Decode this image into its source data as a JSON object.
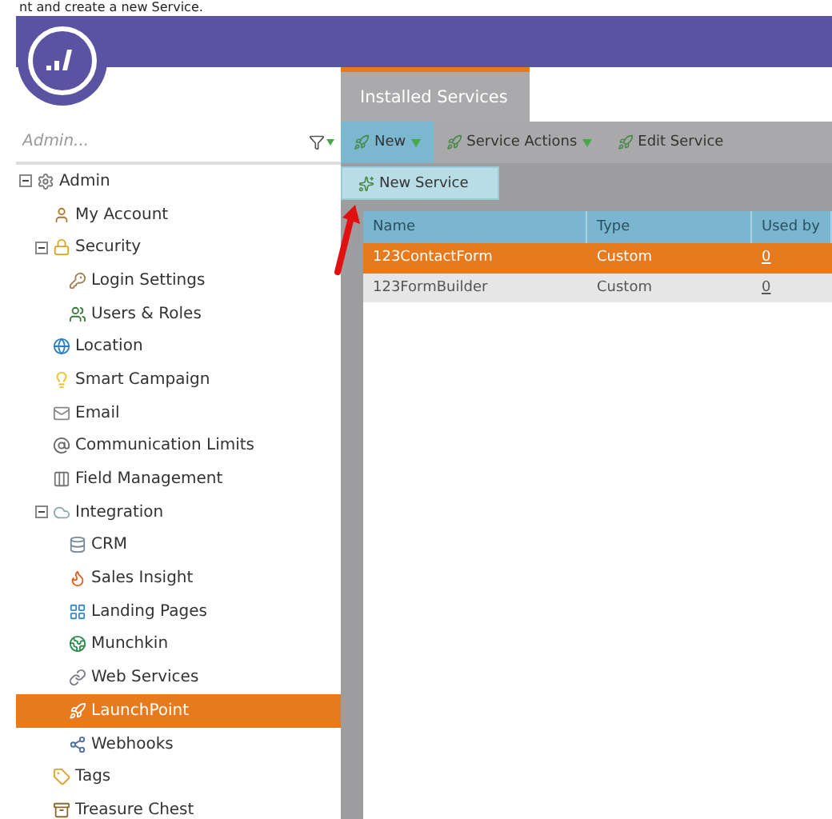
{
  "caption": "nt and create a new Service.",
  "search": {
    "placeholder": "Admin..."
  },
  "tree": [
    {
      "label": "Admin",
      "expanded": true,
      "selected": false,
      "children": [
        {
          "label": "My Account",
          "selected": false
        },
        {
          "label": "Security",
          "expanded": true,
          "selected": false,
          "children": [
            {
              "label": "Login Settings",
              "selected": false
            },
            {
              "label": "Users & Roles",
              "selected": false
            }
          ]
        },
        {
          "label": "Location",
          "selected": false
        },
        {
          "label": "Smart Campaign",
          "selected": false
        },
        {
          "label": "Email",
          "selected": false
        },
        {
          "label": "Communication Limits",
          "selected": false
        },
        {
          "label": "Field Management",
          "selected": false
        },
        {
          "label": "Integration",
          "expanded": true,
          "selected": false,
          "children": [
            {
              "label": "CRM",
              "selected": false
            },
            {
              "label": "Sales Insight",
              "selected": false
            },
            {
              "label": "Landing Pages",
              "selected": false
            },
            {
              "label": "Munchkin",
              "selected": false
            },
            {
              "label": "Web Services",
              "selected": false
            },
            {
              "label": "LaunchPoint",
              "selected": true
            },
            {
              "label": "Webhooks",
              "selected": false
            }
          ]
        },
        {
          "label": "Tags",
          "selected": false
        },
        {
          "label": "Treasure Chest",
          "selected": false
        }
      ]
    }
  ],
  "tabs": [
    {
      "label": "Installed Services",
      "selected": true
    }
  ],
  "toolbar": [
    {
      "label": "New",
      "kind": "menu",
      "open": true
    },
    {
      "label": "Service Actions",
      "kind": "menu",
      "open": false
    },
    {
      "label": "Edit Service",
      "kind": "button",
      "open": false
    }
  ],
  "menu": [
    {
      "label": "New Service"
    }
  ],
  "table": {
    "columns": [
      "Name",
      "Type",
      "Used by"
    ],
    "rows": [
      {
        "name": "123ContactForm",
        "type": "Custom",
        "used_by": "0",
        "selected": true
      },
      {
        "name": "123FormBuilder",
        "type": "Custom",
        "used_by": "0",
        "selected": false
      }
    ]
  }
}
